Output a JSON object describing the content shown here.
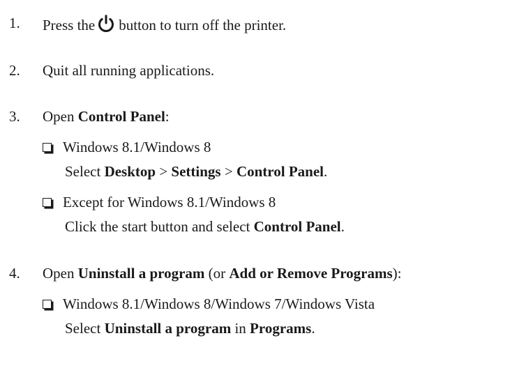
{
  "steps": [
    {
      "number": "1.",
      "text_before": "Press the",
      "icon": "power-icon",
      "text_after": "button to turn off the printer."
    },
    {
      "number": "2.",
      "text": "Quit all running applications."
    },
    {
      "number": "3.",
      "text_before": "Open ",
      "bold": "Control Panel",
      "text_after": ":",
      "options": [
        {
          "title": "Windows 8.1/Windows 8",
          "parts": [
            "Select ",
            "Desktop",
            " > ",
            "Settings",
            " > ",
            "Control Panel",
            "."
          ]
        },
        {
          "title": "Except for Windows 8.1/Windows 8",
          "parts": [
            "Click the start button and select ",
            "Control Panel",
            "."
          ]
        }
      ]
    },
    {
      "number": "4.",
      "parts": [
        "Open ",
        "Uninstall a program",
        " (or ",
        "Add or Remove Programs",
        "):"
      ],
      "options": [
        {
          "title": "Windows 8.1/Windows 8/Windows 7/Windows Vista",
          "parts": [
            "Select ",
            "Uninstall a program",
            " in ",
            "Programs",
            "."
          ]
        }
      ]
    }
  ]
}
